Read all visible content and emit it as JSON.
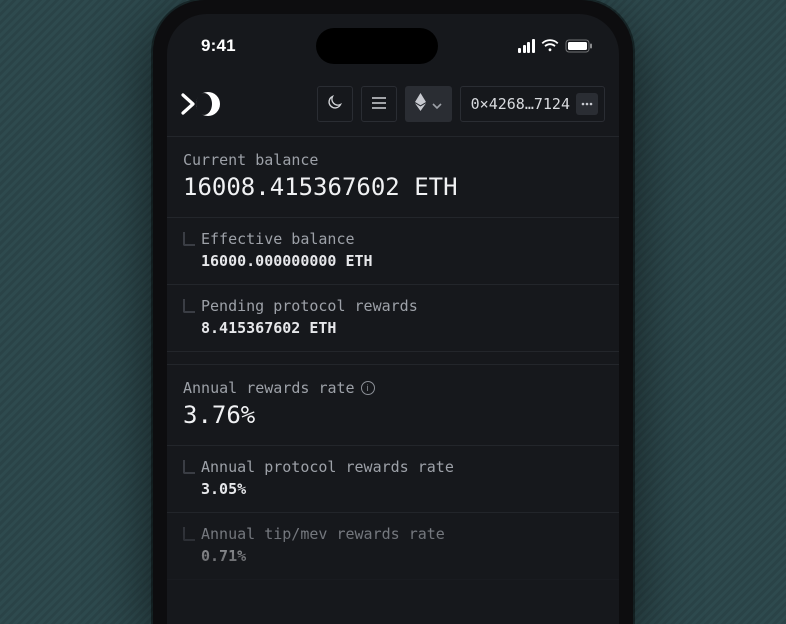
{
  "status": {
    "time": "9:41"
  },
  "header": {
    "address": "0×4268…7124"
  },
  "balance": {
    "label": "Current balance",
    "value": "16008.415367602 ETH",
    "effective_label": "Effective balance",
    "effective_value": "16000.000000000 ETH",
    "pending_label": "Pending protocol rewards",
    "pending_value": "8.415367602 ETH"
  },
  "rewards": {
    "label": "Annual rewards rate",
    "value": "3.76%",
    "protocol_label": "Annual protocol rewards rate",
    "protocol_value": "3.05%",
    "tip_label": "Annual tip/mev rewards rate",
    "tip_value": "0.71%"
  }
}
